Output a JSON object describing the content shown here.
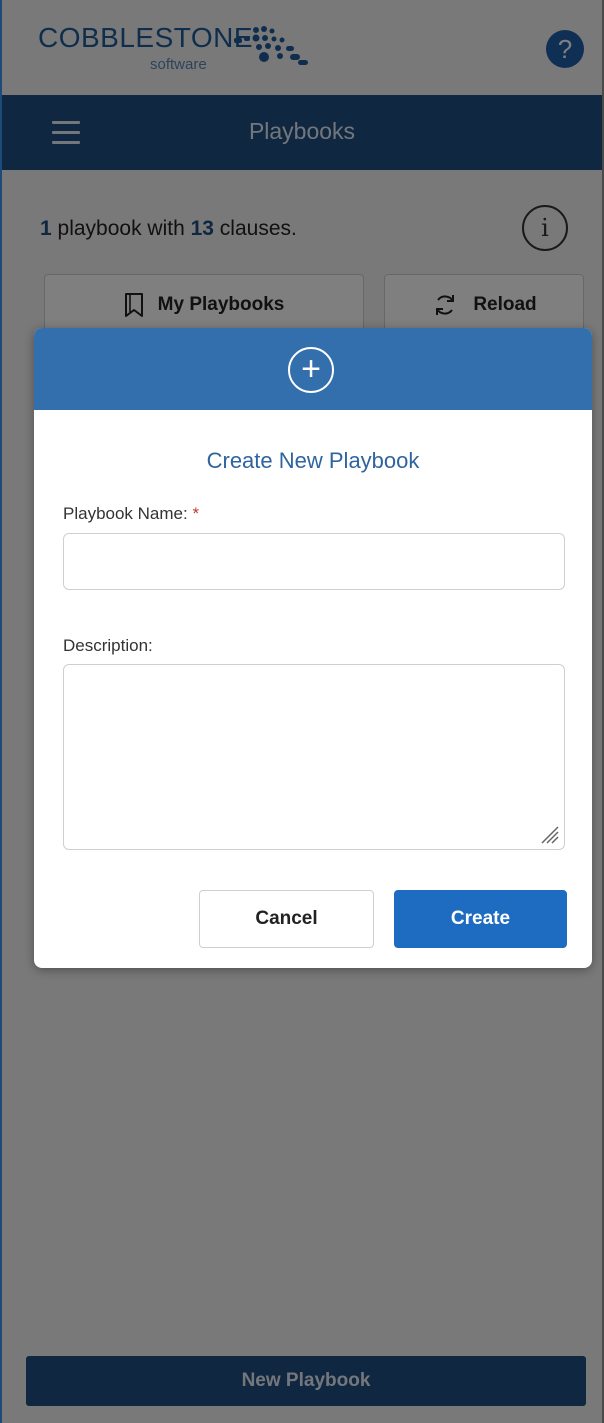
{
  "brand": {
    "logo_text": "COBBLESTONE",
    "logo_sub": "software",
    "help_label": "?",
    "colors": {
      "primary": "#1f4f82",
      "accent": "#1e6cc2",
      "header": "#336fad"
    }
  },
  "nav": {
    "title": "Playbooks",
    "menu_icon": "hamburger-menu-icon"
  },
  "summary": {
    "count_playbooks": "1",
    "text_playbooks": " playbook with ",
    "count_clauses": "13",
    "text_clauses": " clauses."
  },
  "toolbar": {
    "my_playbooks_label": "My Playbooks",
    "reload_label": "Reload"
  },
  "modal": {
    "header_icon": "plus-circle-icon",
    "title": "Create New Playbook",
    "name_label": "Playbook Name:",
    "required_marker": "*",
    "name_value": "",
    "description_label": "Description:",
    "description_value": "",
    "cancel_label": "Cancel",
    "create_label": "Create"
  },
  "footer": {
    "new_playbook_label": "New Playbook"
  }
}
